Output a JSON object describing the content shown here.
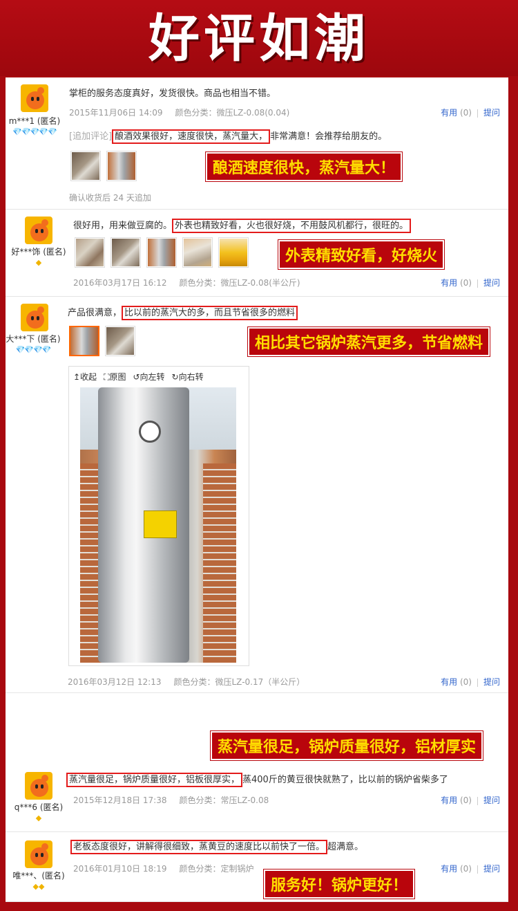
{
  "banner": {
    "title": "好评如潮"
  },
  "labels": {
    "useful": "有用",
    "useful_count": "(0)",
    "ask": "提问",
    "spec_prefix": "颜色分类："
  },
  "reviews": [
    {
      "user": "m***1 (匿名)",
      "rank": "💎💎💎💎💎",
      "text": "掌柜的服务态度真好，发货很快。商品也相当不错。",
      "date": "2015年11月06日 14:09",
      "spec": "微压LZ-0.08(0.04)",
      "append_tag": "[追加评论]",
      "append_highlight": "酿酒效果很好，速度很快，蒸汽量大，",
      "append_rest": "非常满意！会推荐给朋友的。",
      "append_note": "确认收货后 24 天追加",
      "callout": "酿酒速度很快，蒸汽量大！"
    },
    {
      "user": "好***饰 (匿名)",
      "rank": "◆",
      "text_pre": "很好用，用来做豆腐的。",
      "text_highlight": "外表也精致好看，火也很好烧，不用鼓风机都行，很旺的。",
      "date": "2016年03月17日 16:12",
      "spec": "微压LZ-0.08(半公斤)",
      "callout": "外表精致好看，好烧火"
    },
    {
      "user": "大***下 (匿名)",
      "rank": "💎💎💎💎",
      "text_pre": "产品很满意，",
      "text_highlight": "比以前的蒸汽大的多，而且节省很多的燃料",
      "date": "2016年03月12日 12:13",
      "spec": "微压LZ-0.17（半公斤）",
      "callout": "相比其它锅炉蒸汽更多，节省燃料",
      "viewer": {
        "collapse": "↥收起",
        "original": "⛶原图",
        "rotate_left": "↺向左转",
        "rotate_right": "↻向右转"
      }
    },
    {
      "user": "q***6 (匿名)",
      "rank": "◆",
      "text_highlight": "蒸汽量很足，锅炉质量很好，铝板很厚实，",
      "text_rest": "蒸400斤的黄豆很快就熟了，比以前的锅炉省柴多了",
      "date": "2015年12月18日 17:38",
      "spec": "常压LZ-0.08",
      "callout": "蒸汽量很足，锅炉质量很好，铝材厚实"
    },
    {
      "user": "唯***、(匿名)",
      "rank": "◆◆",
      "text_highlight": "老板态度很好，讲解得很细致，蒸黄豆的速度比以前快了一倍。",
      "text_rest": "超满意。",
      "date": "2016年01月10日 18:19",
      "spec": "定制锅炉",
      "callout": "服务好！锅炉更好！"
    }
  ]
}
